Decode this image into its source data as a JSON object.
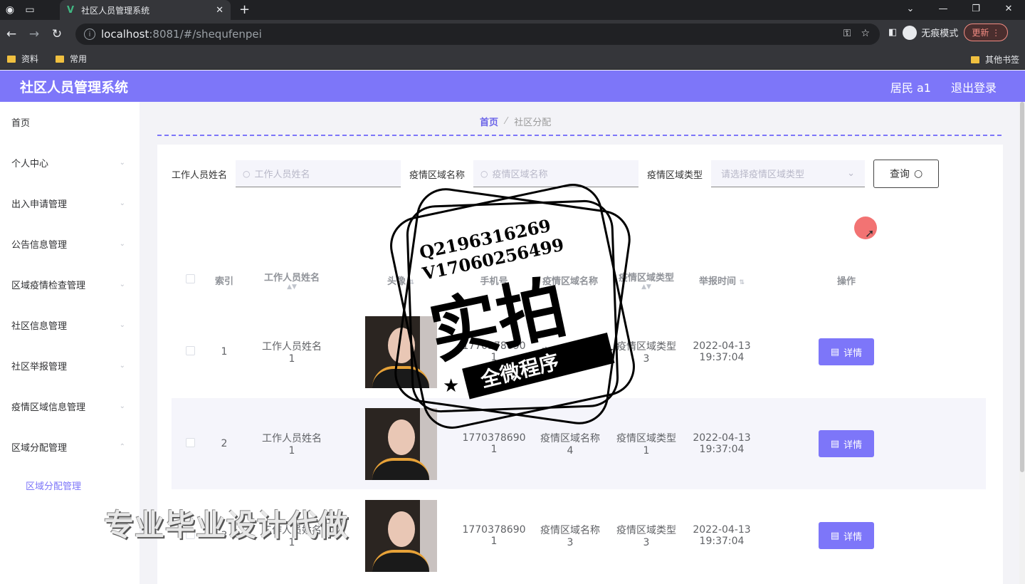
{
  "browser": {
    "tab_title": "社区人员管理系统",
    "url_host": "localhost",
    "url_path": ":8081/#/shequfenpei",
    "incognito_label": "无痕模式",
    "update_label": "更新",
    "bookmarks": [
      "资料",
      "常用"
    ],
    "other_bookmarks": "其他书签"
  },
  "app": {
    "title": "社区人员管理系统",
    "user": "居民 a1",
    "logout": "退出登录"
  },
  "sidebar": {
    "items": [
      {
        "label": "首页"
      },
      {
        "label": "个人中心"
      },
      {
        "label": "出入申请管理"
      },
      {
        "label": "公告信息管理"
      },
      {
        "label": "区域疫情检查管理"
      },
      {
        "label": "社区信息管理"
      },
      {
        "label": "社区举报管理"
      },
      {
        "label": "疫情区域信息管理"
      },
      {
        "label": "区域分配管理"
      }
    ],
    "submenu_label": "区域分配管理"
  },
  "breadcrumb": {
    "home": "首页",
    "current": "社区分配"
  },
  "search": {
    "name_label": "工作人员姓名",
    "name_placeholder": "工作人员姓名",
    "area_label": "疫情区域名称",
    "area_placeholder": "疫情区域名称",
    "type_label": "疫情区域类型",
    "type_placeholder": "请选择疫情区域类型",
    "query_label": "查询"
  },
  "table": {
    "headers": {
      "index": "索引",
      "name": "工作人员姓名",
      "avatar": "头像",
      "phone": "手机号",
      "area_name": "疫情区域名称",
      "area_type": "疫情区域类型",
      "time": "举报时间",
      "action": "操作"
    },
    "detail_label": "详情",
    "rows": [
      {
        "index": "1",
        "name": "工作人员姓名",
        "name_no": "1",
        "phone": "17703786",
        "phone2": "90",
        "phone_no": "1",
        "area_name": "疫情区域名称",
        "area_no": "",
        "area_type": "疫情区域类型",
        "type_no": "3",
        "date": "2022-04-13",
        "time": "19:37:04"
      },
      {
        "index": "2",
        "name": "工作人员姓名",
        "name_no": "1",
        "phone": "1770378690",
        "phone2": "",
        "phone_no": "1",
        "area_name": "疫情区域名称",
        "area_no": "4",
        "area_type": "疫情区域类型",
        "type_no": "1",
        "date": "2022-04-13",
        "time": "19:37:04"
      },
      {
        "index": "3",
        "name": "工作人员姓名",
        "name_no": "1",
        "phone": "1770378690",
        "phone2": "",
        "phone_no": "1",
        "area_name": "疫情区域名称",
        "area_no": "3",
        "area_type": "疫情区域类型",
        "type_no": "3",
        "date": "2022-04-13",
        "time": "19:37:04"
      }
    ]
  },
  "overlay": {
    "stamp_line1": "Q2196316269",
    "stamp_line2": "V17060256499",
    "stamp_big": "实拍",
    "stamp_banner": "全微程序",
    "watermark": "专业毕业设计代做"
  },
  "colors": {
    "accent": "#7d76f9",
    "chrome": "#202124"
  }
}
